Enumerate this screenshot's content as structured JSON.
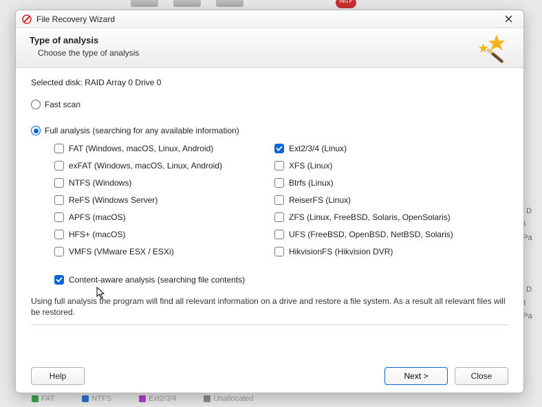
{
  "window": {
    "title": "File Recovery Wizard"
  },
  "header": {
    "title": "Type of analysis",
    "subtitle": "Choose the type of analysis"
  },
  "selectedDisk": {
    "label": "Selected disk:",
    "value": "RAID Array 0 Drive 0"
  },
  "scanModes": {
    "fast": {
      "label": "Fast scan",
      "selected": false
    },
    "full": {
      "label": "Full analysis (searching for any available information)",
      "selected": true
    }
  },
  "filesystems": {
    "left": [
      {
        "id": "fat",
        "label": "FAT (Windows, macOS, Linux, Android)",
        "checked": false
      },
      {
        "id": "exfat",
        "label": "exFAT (Windows, macOS, Linux, Android)",
        "checked": false
      },
      {
        "id": "ntfs",
        "label": "NTFS (Windows)",
        "checked": false
      },
      {
        "id": "refs",
        "label": "ReFS (Windows Server)",
        "checked": false
      },
      {
        "id": "apfs",
        "label": "APFS (macOS)",
        "checked": false
      },
      {
        "id": "hfs",
        "label": "HFS+ (macOS)",
        "checked": false
      },
      {
        "id": "vmfs",
        "label": "VMFS (VMware ESX / ESXi)",
        "checked": false
      }
    ],
    "right": [
      {
        "id": "ext",
        "label": "Ext2/3/4 (Linux)",
        "checked": true
      },
      {
        "id": "xfs",
        "label": "XFS (Linux)",
        "checked": false
      },
      {
        "id": "btrfs",
        "label": "Btrfs (Linux)",
        "checked": false
      },
      {
        "id": "reiser",
        "label": "ReiserFS (Linux)",
        "checked": false
      },
      {
        "id": "zfs",
        "label": "ZFS (Linux, FreeBSD, Solaris, OpenSolaris)",
        "checked": false
      },
      {
        "id": "ufs",
        "label": "UFS (FreeBSD, OpenBSD, NetBSD, Solaris)",
        "checked": false
      },
      {
        "id": "hikfs",
        "label": "HikvisionFS (Hikvision DVR)",
        "checked": false
      }
    ]
  },
  "contentAware": {
    "label": "Content-aware analysis (searching file contents)",
    "checked": true
  },
  "description": "Using full analysis the program will find all relevant information on a drive and restore a file system. As a result all relevant files will be restored.",
  "buttons": {
    "help": "Help",
    "next": "Next >",
    "close": "Close"
  },
  "backgroundLegend": {
    "fat": {
      "label": "FAT",
      "color": "#37a24a"
    },
    "ntfs": {
      "label": "NTFS",
      "color": "#2d6fd1"
    },
    "ext": {
      "label": "Ext2/3/4",
      "color": "#b43ad1"
    },
    "unall": {
      "label": "Unallocated",
      "color": "#8a8a8a"
    }
  },
  "backgroundPeek": {
    "t1": "cal D",
    "t2": "MB",
    "t3": "ry Pa"
  },
  "bgToolbar": {
    "help": "HELP"
  }
}
